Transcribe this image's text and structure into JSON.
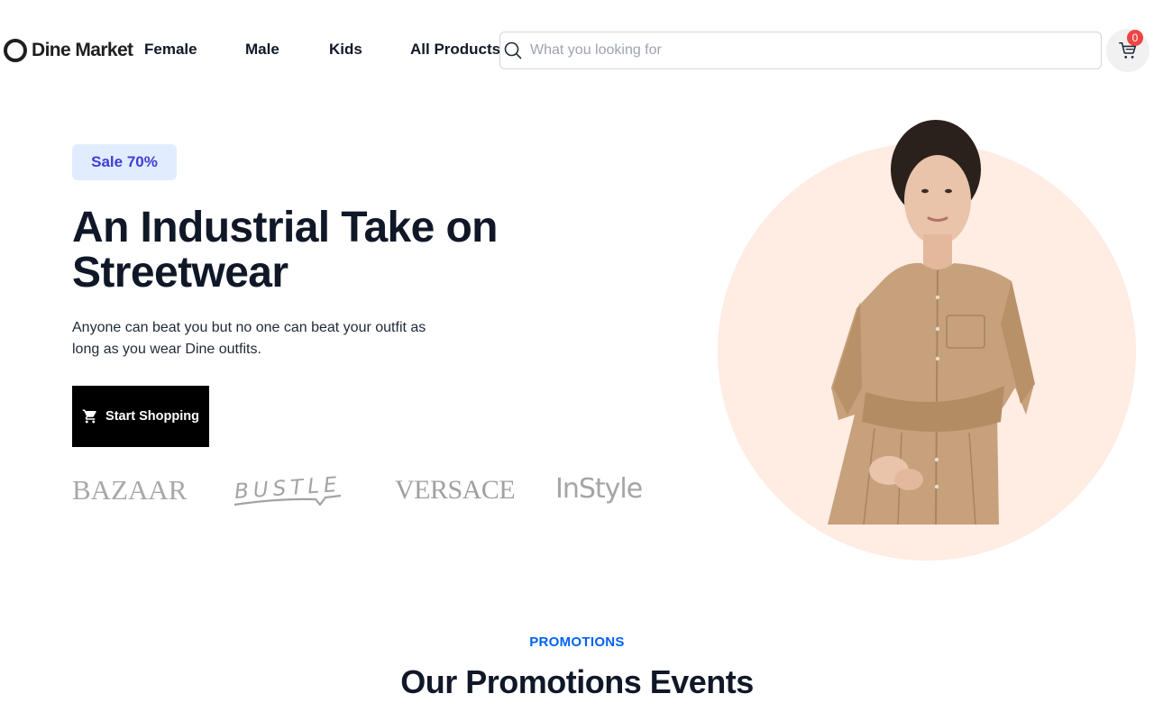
{
  "brand": {
    "name": "Dine Market"
  },
  "nav": {
    "items": [
      {
        "label": "Female"
      },
      {
        "label": "Male"
      },
      {
        "label": "Kids"
      },
      {
        "label": "All Products"
      }
    ]
  },
  "search": {
    "placeholder": "What you looking for",
    "value": "",
    "icon": "search-icon"
  },
  "cart": {
    "count": "0",
    "icon": "cart-icon",
    "badge_color": "#ef4444"
  },
  "hero": {
    "badge": "Sale 70%",
    "title": "An Industrial Take on Streetwear",
    "subtitle": "Anyone can beat you but no one can beat your outfit as long as you wear Dine outfits.",
    "cta_label": "Start Shopping",
    "cta_icon": "cart-icon",
    "brands": [
      "BAZAAR",
      "BUSTLE",
      "VERSACE",
      "InStyle"
    ],
    "image_alt": "model-in-beige-shirt-dress"
  },
  "promotions": {
    "kicker": "PROMOTIONS",
    "title": "Our Promotions Events"
  },
  "colors": {
    "accent": "#0062f5",
    "badge_bg": "#e1edff",
    "badge_text": "#3f3dd8",
    "hero_circle": "#ffece3",
    "text_dark": "#101828"
  }
}
